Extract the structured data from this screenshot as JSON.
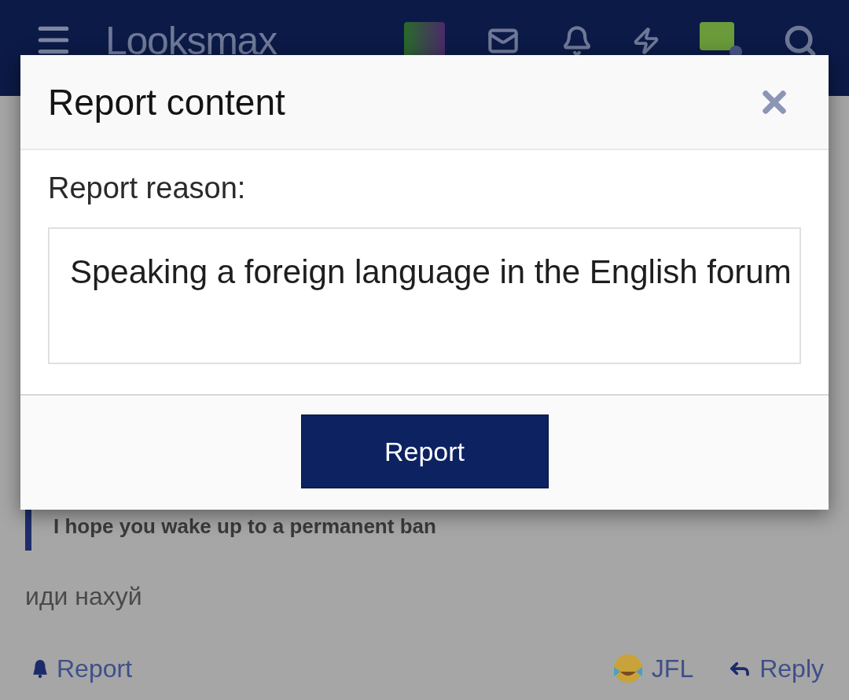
{
  "top_bar": {
    "logo": "Looksmax"
  },
  "background_post": {
    "quote": "I hope you wake up to a permanent ban",
    "text": "иди нахуй",
    "actions": [
      {
        "kind": "report",
        "label": "Report"
      },
      {
        "kind": "reaction",
        "label": "JFL"
      },
      {
        "kind": "reply",
        "label": "Reply"
      }
    ]
  },
  "dialog": {
    "title": "Report content",
    "reason_label": "Report reason:",
    "reason_field": {
      "value": "Speaking a foreign language in the English forum"
    },
    "submit_button": "Report"
  }
}
